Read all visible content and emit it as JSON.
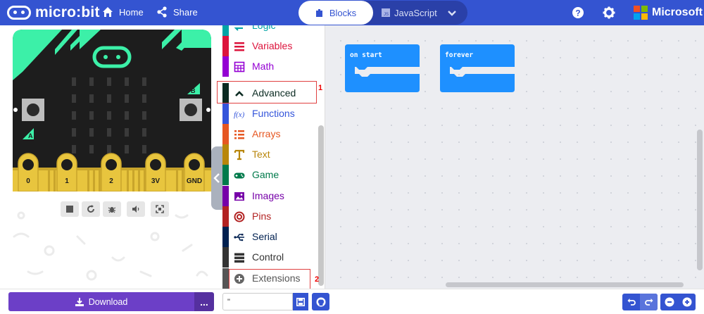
{
  "header": {
    "brand": "micro:bit",
    "home_label": "Home",
    "share_label": "Share",
    "tab_blocks": "Blocks",
    "tab_javascript": "JavaScript",
    "microsoft_label": "Microsoft"
  },
  "simulator": {
    "pins": [
      "0",
      "1",
      "2",
      "3V",
      "GND"
    ],
    "button_a": "A",
    "button_b": "B"
  },
  "toolbox": {
    "categories": [
      {
        "label": "Logic",
        "color": "#00a4a6"
      },
      {
        "label": "Variables",
        "color": "#dc143c"
      },
      {
        "label": "Math",
        "color": "#9400d3"
      },
      {
        "label": "Advanced",
        "color": "#0b2b22"
      },
      {
        "label": "Functions",
        "color": "#3455db"
      },
      {
        "label": "Arrays",
        "color": "#e65722"
      },
      {
        "label": "Text",
        "color": "#b8860b"
      },
      {
        "label": "Game",
        "color": "#007a4b"
      },
      {
        "label": "Images",
        "color": "#7600a8"
      },
      {
        "label": "Pins",
        "color": "#b22222"
      },
      {
        "label": "Serial",
        "color": "#002050"
      },
      {
        "label": "Control",
        "color": "#333333"
      },
      {
        "label": "Extensions",
        "color": "#555555"
      }
    ],
    "annotation_1": "1",
    "annotation_2": "2"
  },
  "workspace": {
    "block_on_start": "on start",
    "block_forever": "forever",
    "block_color": "#1e90ff"
  },
  "bottom": {
    "download_label": "Download",
    "more_label": "...",
    "project_name": "\""
  }
}
